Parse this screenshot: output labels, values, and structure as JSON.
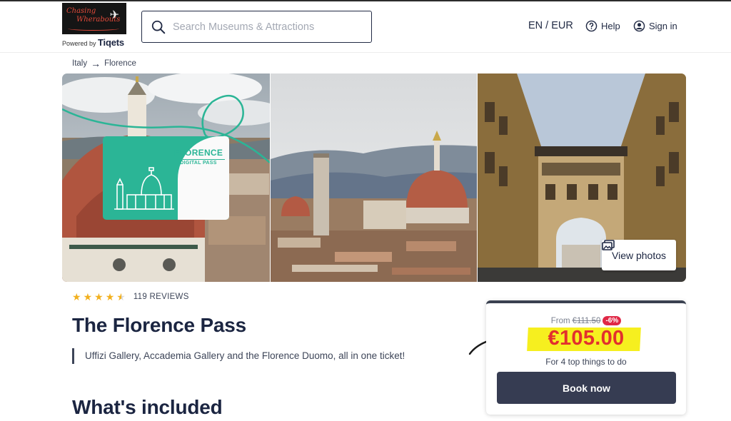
{
  "header": {
    "logo_line1": "Chasing",
    "logo_line2": "Wherabouts",
    "powered_by": "Powered by",
    "powered_brand": "Tiqets",
    "search_placeholder": "Search Museums & Attractions",
    "language_currency": "EN / EUR",
    "help_label": "Help",
    "signin_label": "Sign in"
  },
  "breadcrumb": {
    "items": [
      "Italy",
      "Florence"
    ]
  },
  "gallery": {
    "pass_title": "FLORENCE",
    "pass_subtitle": "DIGITAL PASS",
    "view_photos_label": "View photos"
  },
  "product": {
    "rating": 4.5,
    "reviews_label": "119 REVIEWS",
    "title": "The Florence Pass",
    "description": "Uffizi Gallery, Accademia Gallery and the Florence Duomo, all in one ticket!",
    "section_heading": "What's included"
  },
  "pricing": {
    "from_label": "From",
    "old_price": "€111.50",
    "discount": "-6%",
    "price": "€105.00",
    "subtitle": "For 4 top things to do",
    "book_label": "Book now",
    "highlight_color": "#f6ef1f",
    "price_color": "#e2302d"
  },
  "colors": {
    "navy": "#1b2541",
    "button": "#363c52",
    "star": "#f2b01e",
    "pass_green": "#2bb596",
    "discount_red": "#e02846"
  }
}
